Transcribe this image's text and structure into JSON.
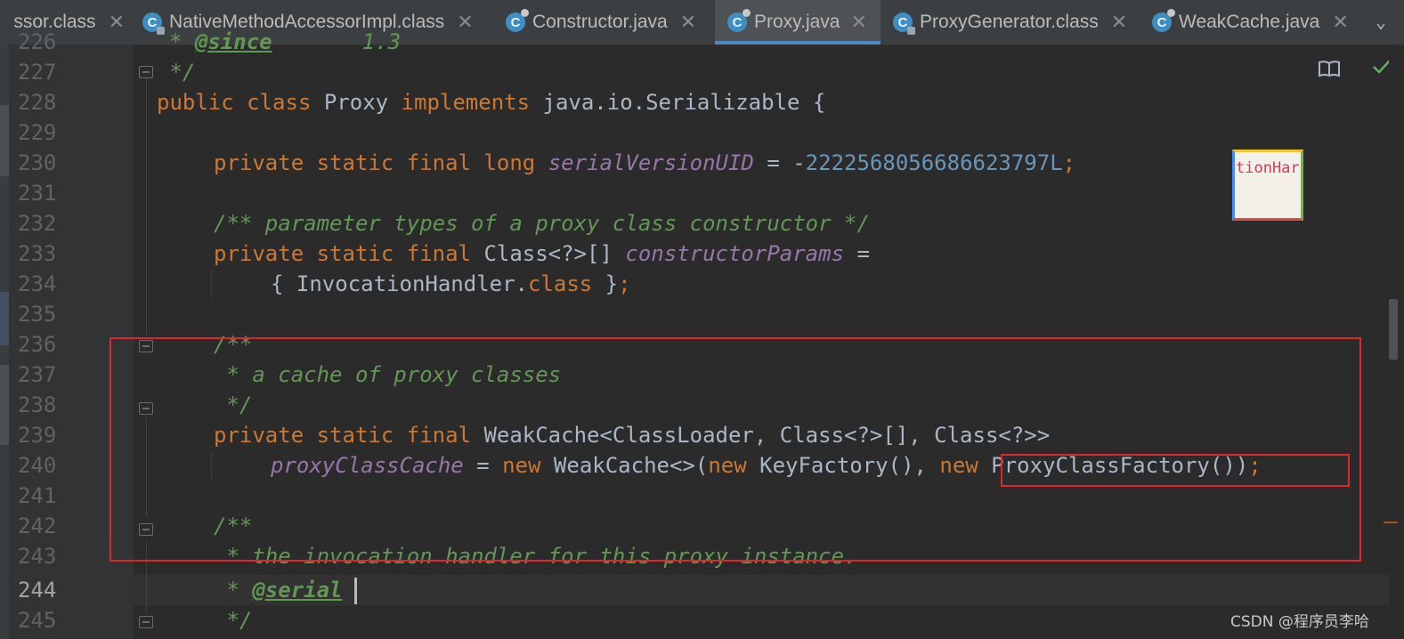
{
  "tabs": [
    {
      "label": "ssor.class",
      "type": "class",
      "active": false
    },
    {
      "label": "NativeMethodAccessorImpl.class",
      "type": "class",
      "active": false
    },
    {
      "label": "Constructor.java",
      "type": "java",
      "active": false
    },
    {
      "label": "Proxy.java",
      "type": "java",
      "active": true
    },
    {
      "label": "ProxyGenerator.class",
      "type": "class",
      "active": false
    },
    {
      "label": "WeakCache.java",
      "type": "java",
      "active": false
    }
  ],
  "tab_icon_letter": "C",
  "close_glyph": "✕",
  "overflow_glyph": "⌄",
  "line_numbers": [
    "226",
    "227",
    "228",
    "229",
    "230",
    "231",
    "232",
    "233",
    "234",
    "235",
    "236",
    "237",
    "238",
    "239",
    "240",
    "241",
    "242",
    "243",
    "244",
    "245"
  ],
  "code": {
    "l226_tag": "@since",
    "l226_val": "1.3",
    "l227": " */",
    "l228_a": "public class",
    "l228_b": " Proxy ",
    "l228_c": "implements",
    "l228_d": " java.io.Serializable {",
    "l230_a": "private static final long ",
    "l230_b": "serialVersionUID",
    "l230_c": " = -",
    "l230_d": "2222568056686623797L",
    "l230_e": ";",
    "l232": "/** parameter types of a proxy class constructor */",
    "l233_a": "private static final ",
    "l233_b": "Class<?>[] ",
    "l233_c": "constructorParams",
    "l233_d": " =",
    "l234_a": "{ InvocationHandler.",
    "l234_b": "class",
    "l234_c": " }",
    "l234_d": ";",
    "l236": "/**",
    "l237": " * a cache of proxy classes",
    "l238": " */",
    "l239_a": "private static final ",
    "l239_b": "WeakCache<ClassLoader, Class<?>[], Class<?>>",
    "l240_a": "proxyClassCache",
    "l240_b": " = ",
    "l240_c": "new",
    "l240_d": " WeakCache<>(",
    "l240_e": "new",
    "l240_f": " KeyFactory(), ",
    "l240_g": "new",
    "l240_h": " ProxyClassFactory())",
    "l240_i": ";",
    "l242": "/**",
    "l243": " * the invocation handler for this proxy instance.",
    "l244_a": " * ",
    "l244_b": "@serial",
    "l245": " */"
  },
  "popup_text": "tionHar",
  "reader_mode_icon": "reader-mode-icon",
  "inspection_ok_icon": "check-icon",
  "watermark": "CSDN @程序员李哈",
  "colors": {
    "keyword": "#cc7832",
    "comment": "#629755",
    "field": "#9876aa",
    "number": "#6897bb",
    "highlight": "#e0252d"
  }
}
